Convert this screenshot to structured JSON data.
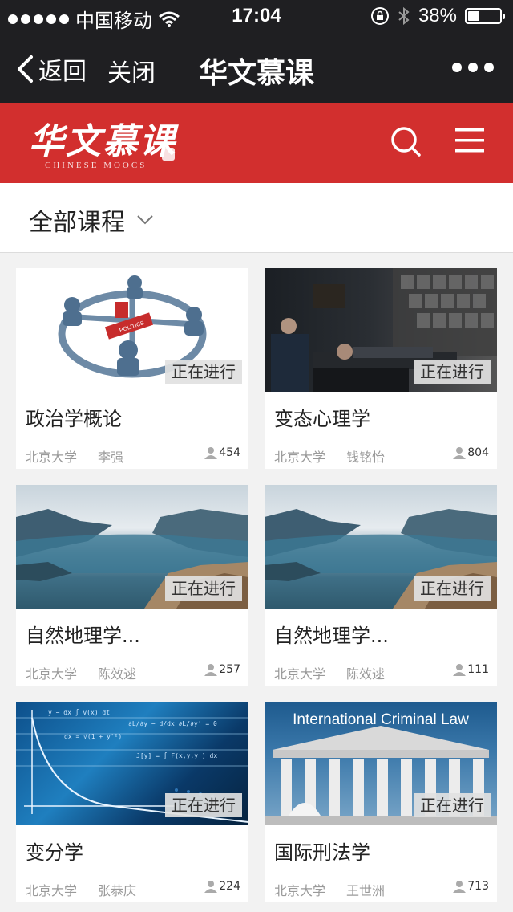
{
  "status_bar": {
    "carrier": "中国移动",
    "time": "17:04",
    "battery_percent_text": "38%",
    "battery_level": 0.38
  },
  "nav": {
    "back_label": "返回",
    "close_label": "关闭",
    "title": "华文慕课"
  },
  "brand": {
    "logo_main": "华文慕课",
    "logo_sub": "CHINESE MOOCS",
    "accent_color": "#d22f2e"
  },
  "filter": {
    "label": "全部课程"
  },
  "courses": [
    {
      "title": "政治学概论",
      "university": "北京大学",
      "teacher": "李强",
      "students": "454",
      "status": "正在进行",
      "thumb": "politics-network-illustration"
    },
    {
      "title": "变态心理学",
      "university": "北京大学",
      "teacher": "钱铭怡",
      "students": "804",
      "status": "正在进行",
      "thumb": "dark-film-still"
    },
    {
      "title": "自然地理学...",
      "university": "北京大学",
      "teacher": "陈效逑",
      "students": "257",
      "status": "正在进行",
      "thumb": "fjord-landscape"
    },
    {
      "title": "自然地理学...",
      "university": "北京大学",
      "teacher": "陈效逑",
      "students": "111",
      "status": "正在进行",
      "thumb": "fjord-landscape"
    },
    {
      "title": "变分学",
      "university": "北京大学",
      "teacher": "张恭庆",
      "students": "224",
      "status": "正在进行",
      "thumb": "math-formulas-blue"
    },
    {
      "title": "国际刑法学",
      "university": "北京大学",
      "teacher": "王世洲",
      "students": "713",
      "status": "正在进行",
      "thumb": "courthouse-columns",
      "thumb_text": "International Criminal Law"
    }
  ]
}
